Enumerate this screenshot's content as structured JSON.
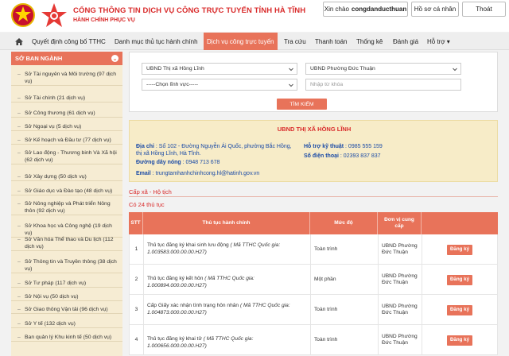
{
  "header": {
    "title": "CỔNG THÔNG TIN DỊCH VỤ CÔNG TRỰC TUYẾN TỈNH HÀ TĨNH",
    "subtitle": "HÀNH CHÍNH PHỤC VỤ",
    "greeting": "Xin chào",
    "username": "congdanducthuan",
    "profile_label": "Hồ sơ cá nhân",
    "logout_label": "Thoát"
  },
  "nav": {
    "items": [
      "Quyết định công bố TTHC",
      "Danh mục thủ tục hành chính",
      "Dịch vụ công trực tuyến",
      "Tra cứu",
      "Thanh toán",
      "Thống kê",
      "Đánh giá",
      "Hỗ trợ ▾"
    ],
    "active_index": 2
  },
  "sidebar": {
    "heading": "SỞ BAN NGÀNH",
    "items": [
      "Sở Tài nguyên và Môi trường (97 dịch vụ)",
      "Sở Tài chính (21 dịch vụ)",
      "Sở Công thương (61 dịch vụ)",
      "Sở Ngoại vụ (5 dịch vụ)",
      "Sở Kế hoạch và Đầu tư (77 dịch vụ)",
      "Sở Lao động - Thương binh Và Xã hội (62 dịch vụ)",
      "Sở Xây dựng (50 dịch vụ)",
      "Sở Giáo dục và Đào tạo (48 dịch vụ)",
      "Sở Nông nghiệp và Phát triển Nông thôn (92 dịch vụ)",
      "Sở Khoa học và Công nghệ (19 dịch vụ)",
      "Sở Văn hóa Thể thao và Du lịch (112 dịch vụ)",
      "Sở Thông tin và Truyền thông (38 dịch vụ)",
      "Sở Tư pháp (117 dịch vụ)",
      "Sở Nội vụ (50 dịch vụ)",
      "Sở Giao thông Vận tải (96 dịch vụ)",
      "Sở Y tế (132 dịch vụ)",
      "Ban quản lý Khu kinh tế (50 dịch vụ)"
    ]
  },
  "search": {
    "district": "UBND Thị xã Hồng Lĩnh",
    "ward": "UBND Phường Đức Thuận",
    "field": "-----Chọn lĩnh vực-----",
    "keyword_placeholder": "Nhập từ khóa",
    "button": "TÌM KIẾM"
  },
  "info": {
    "title": "UBND THỊ XÃ HỒNG LĨNH",
    "address_label": "Địa chỉ",
    "address": ": Số 102 - Đường Nguyễn Ái Quốc, phường Bắc Hồng, thị xã Hồng Lĩnh, Hà Tĩnh.",
    "hotline_label": "Đường dây nóng",
    "hotline": ": 0948 713 678",
    "email_label": "Email",
    "email": ": trungtamhanhchinhcong.hl@hatinh.gov.vn",
    "support_label": "Hỗ trợ kỹ thuật",
    "support": ": 0985 555 159",
    "phone_label": "Số điện thoại",
    "phone": ": 02393 837 837"
  },
  "section": {
    "title": "Cấp xã - Hộ tịch",
    "count": "Có 24 thủ tục"
  },
  "table": {
    "headers": [
      "STT",
      "Thủ tục hành chính",
      "Mức độ",
      "Đơn vị cung cấp",
      ""
    ],
    "rows": [
      {
        "stt": "1",
        "name": "Thủ tục đăng ký khai sinh lưu động",
        "code": "( Mã TTHC Quốc gia: 1.003583.000.00.00.H27)",
        "level": "Toàn trình",
        "unit": "UBND Phường Đức Thuận",
        "action": "Đăng ký"
      },
      {
        "stt": "2",
        "name": "Thủ tục đăng ký kết hôn",
        "code": "( Mã TTHC Quốc gia: 1.000894.000.00.00.H27)",
        "level": "Một phần",
        "unit": "UBND Phường Đức Thuận",
        "action": "Đăng ký"
      },
      {
        "stt": "3",
        "name": "Cấp Giấy xác nhận tình trạng hôn nhân",
        "code": "( Mã TTHC Quốc gia: 1.004873.000.00.00.H27)",
        "level": "Toàn trình",
        "unit": "UBND Phường Đức Thuận",
        "action": "Đăng ký"
      },
      {
        "stt": "4",
        "name": "Thủ tục đăng ký khai tử",
        "code": "( Mã TTHC Quốc gia: 1.000656.000.00.00.H27)",
        "level": "Toàn trình",
        "unit": "UBND Phường Đức Thuận",
        "action": "Đăng ký"
      }
    ]
  },
  "colors": {
    "accent": "#e8735a",
    "title_red": "#d92b2b",
    "sidebar_bg": "#f6ecd3",
    "info_bg": "#f7ecc8",
    "link_blue": "#1a4aa6"
  }
}
